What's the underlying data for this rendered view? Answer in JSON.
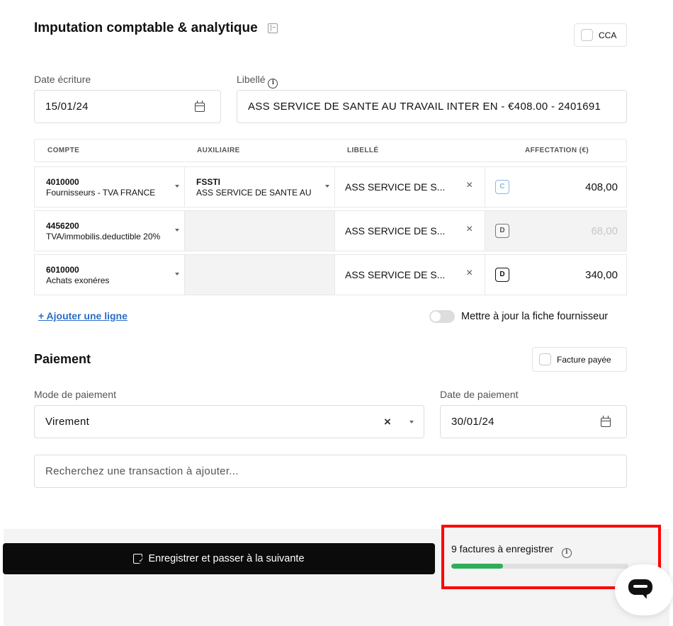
{
  "imputation": {
    "title": "Imputation comptable & analytique",
    "cca_label": "CCA",
    "date_label": "Date écriture",
    "date_value": "15/01/24",
    "libelle_label": "Libellé",
    "libelle_value": "ASS SERVICE DE SANTE AU TRAVAIL INTER EN - €408.00 - 2401691"
  },
  "table": {
    "headers": [
      "COMPTE",
      "AUXILIAIRE",
      "LIBELLÉ",
      "AFFECTATION (€)"
    ],
    "rows": [
      {
        "account_num": "4010000",
        "account_name": "Fournisseurs - TVA FRANCE",
        "aux_code": "FSSTI",
        "aux_name": "ASS SERVICE DE SANTE AU",
        "libelle": "ASS SERVICE DE S...",
        "clear": "×",
        "badge": "C",
        "amount": "408,00"
      },
      {
        "account_num": "4456200",
        "account_name": "TVA/immobilis.deductible 20%",
        "aux_code": "",
        "aux_name": "",
        "libelle": "ASS SERVICE DE S...",
        "clear": "×",
        "badge": "D",
        "amount": "68,00"
      },
      {
        "account_num": "6010000",
        "account_name": "Achats exonéres",
        "aux_code": "",
        "aux_name": "",
        "libelle": "ASS SERVICE DE S...",
        "clear": "×",
        "badge": "D",
        "amount": "340,00"
      }
    ],
    "add_line": "+ Ajouter une ligne",
    "update_supplier_label": "Mettre à jour la fiche fournisseur"
  },
  "paiement": {
    "title": "Paiement",
    "paid_label": "Facture payée",
    "mode_label": "Mode de paiement",
    "mode_value": "Virement",
    "date_label": "Date de paiement",
    "date_value": "30/01/24",
    "search_placeholder": "Recherchez une transaction à ajouter..."
  },
  "footer": {
    "save_label": "Enregistrer et passer à la suivante",
    "pending_text": "9 factures à enregistrer",
    "progress_fraction": 0.29
  },
  "colors": {
    "accent_link": "#2b6ec8",
    "progress": "#2eae5b",
    "highlight": "#ff0000",
    "badge_c": "#8ab6e8"
  }
}
